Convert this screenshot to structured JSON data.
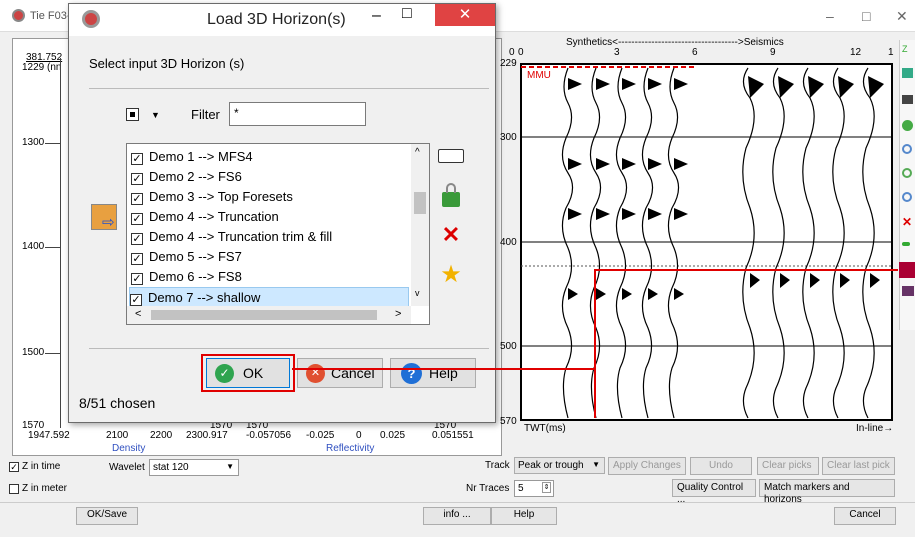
{
  "main": {
    "title": "Tie F03-",
    "controls": {
      "minimize": "–",
      "maximize": "□",
      "close": "✕"
    },
    "left_plot": {
      "density_top": "381.752",
      "density_top2": "1229 (nn",
      "depth_ticks": [
        "1300",
        "1400",
        "1500",
        "1570"
      ],
      "density_ticks": [
        "1947.592",
        "2100",
        "2200",
        "2300.917"
      ],
      "density_tick_top": "1570",
      "density_label": "Density",
      "refl_ticks": [
        "-0.057056",
        "-0.025",
        "0",
        "0.025",
        "0.051551"
      ],
      "refl_tick_top_left": "1570",
      "refl_tick_top_right": "1570",
      "refl_label": "Reflectivity"
    },
    "seismic": {
      "header": "Synthetics<------------------------------------>Seismics",
      "x_ticks": [
        "0",
        "3",
        "6",
        "9",
        "12",
        "1"
      ],
      "x_tick_0b": "0",
      "y_ticks": [
        "229",
        "300",
        "400",
        "500",
        "570"
      ],
      "horizon_label": "MMU",
      "bottom_left": "TWT(ms)",
      "bottom_right": "In-line→"
    },
    "options": {
      "z_in_time": "Z in time",
      "z_in_meter": "Z in meter",
      "wavelet_label": "Wavelet",
      "wavelet_value": "stat 120",
      "track_label": "Track",
      "track_value": "Peak or trough",
      "apply_changes": "Apply Changes",
      "undo": "Undo",
      "clear_picks": "Clear picks",
      "clear_last_pick": "Clear last pick",
      "nr_traces_label": "Nr Traces",
      "nr_traces_value": "5",
      "quality_control": "Quality Control ...",
      "match_markers": "Match markers and horizons"
    },
    "footer": {
      "ok_save": "OK/Save",
      "info": "info ...",
      "help": "Help",
      "cancel": "Cancel"
    }
  },
  "dialog": {
    "title": "Load 3D Horizon(s)",
    "controls": {
      "minimize": "–",
      "maximize": "□",
      "close": "✕"
    },
    "prompt": "Select input 3D Horizon (s)",
    "filter_label": "Filter",
    "filter_value": "*",
    "items": [
      "Demo 1 --> MFS4",
      "Demo 2 --> FS6",
      "Demo 3  --> Top Foresets",
      "Demo 4 --> Truncation",
      "Demo 4 --> Truncation trim & fill",
      "Demo 5 --> FS7",
      "Demo 6 --> FS8",
      "Demo 7 --> shallow"
    ],
    "selected_index": 7,
    "status": "8/51 chosen",
    "buttons": {
      "ok": "OK",
      "cancel": "Cancel",
      "help": "Help"
    }
  },
  "colors": {
    "highlight": "#e00000",
    "accent": "#0078d7",
    "close_red": "#e04343"
  }
}
